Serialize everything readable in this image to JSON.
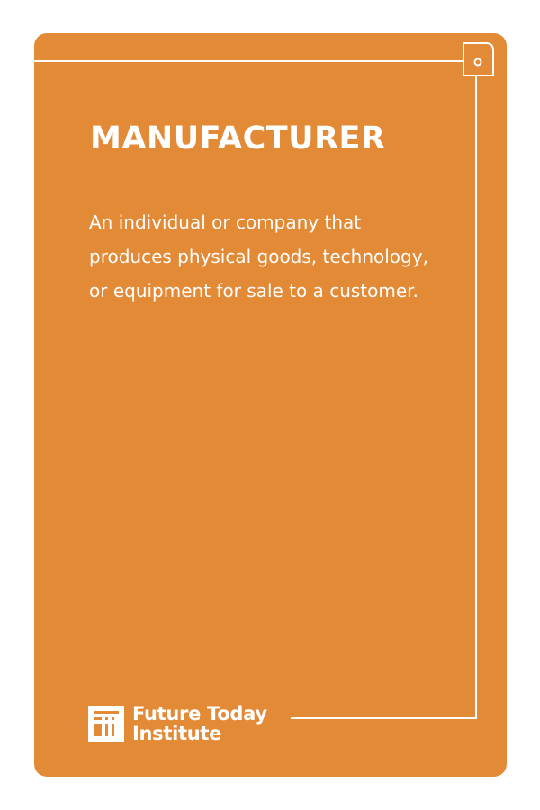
{
  "card": {
    "title": "MANUFACTURER",
    "description": "An individual or company that produces physical goods, technology, or equipment for sale to a customer.",
    "background_color": "#e38a37",
    "text_color": "#ffffff"
  },
  "brand": {
    "line1": "Future Today",
    "line2": "Institute",
    "logo_icon": "fti-logo-icon"
  }
}
